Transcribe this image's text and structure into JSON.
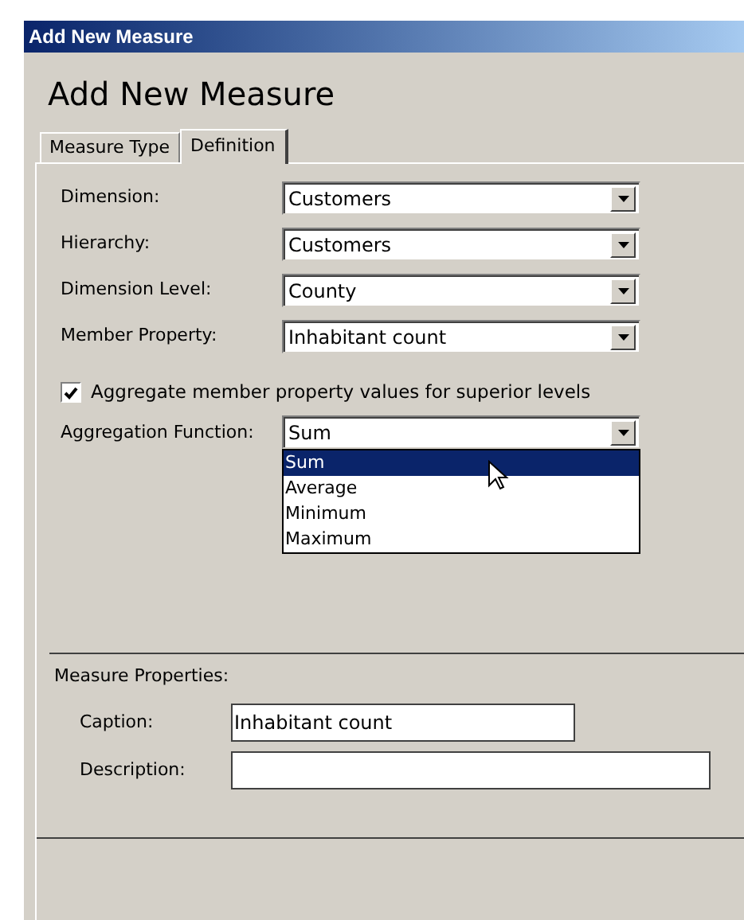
{
  "window": {
    "title": "Add New Measure"
  },
  "heading": "Add New Measure",
  "tabs": [
    {
      "label": "Measure Type",
      "selected": false
    },
    {
      "label": "Definition",
      "selected": true
    }
  ],
  "fields": [
    {
      "label": "Dimension:",
      "value": "Customers"
    },
    {
      "label": "Hierarchy:",
      "value": "Customers"
    },
    {
      "label": "Dimension Level:",
      "value": "County"
    },
    {
      "label": "Member Property:",
      "value": "Inhabitant count"
    }
  ],
  "aggregate_checkbox": {
    "label": "Aggregate member property values for superior levels",
    "checked": true
  },
  "aggregation_function": {
    "label": "Aggregation Function:",
    "value": "Sum",
    "expanded": true,
    "options": [
      {
        "label": "Sum",
        "selected": true
      },
      {
        "label": "Average",
        "selected": false
      },
      {
        "label": "Minimum",
        "selected": false
      },
      {
        "label": "Maximum",
        "selected": false
      }
    ]
  },
  "measure_properties": {
    "title": "Measure Properties:",
    "fields": [
      {
        "label": "Caption:",
        "value": "Inhabitant count",
        "wide": false
      },
      {
        "label": "Description:",
        "wide": true
      }
    ]
  }
}
